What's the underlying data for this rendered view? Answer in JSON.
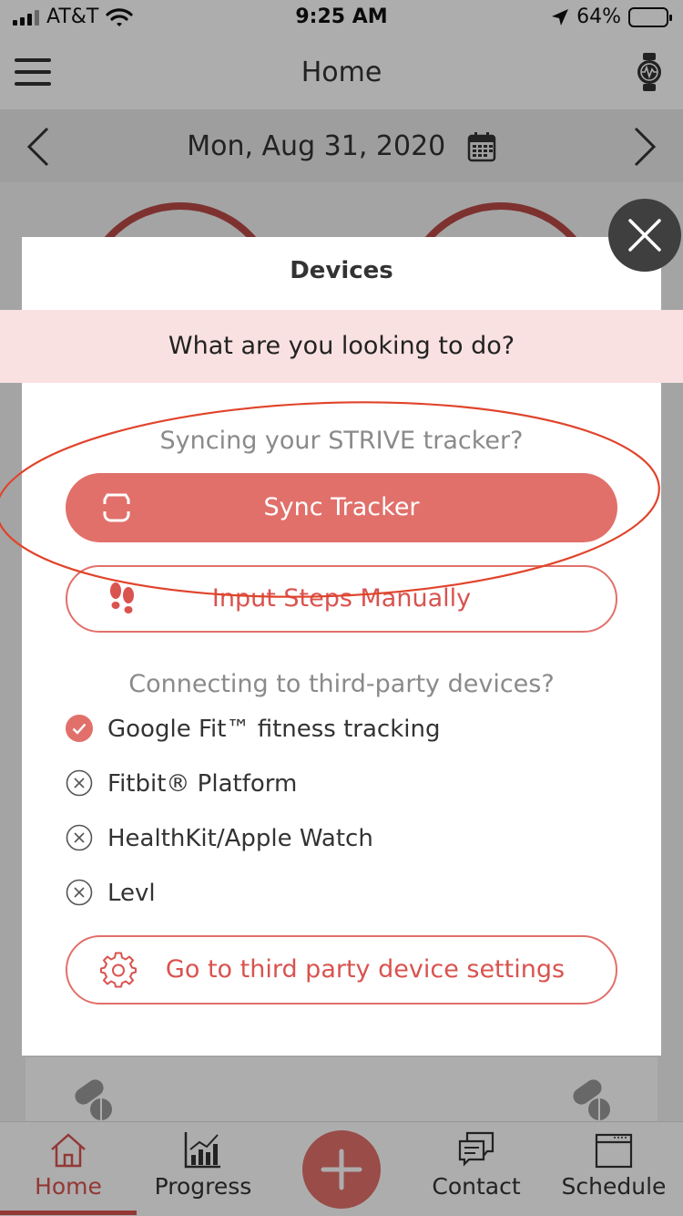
{
  "status_bar": {
    "carrier": "AT&T",
    "time": "9:25 AM",
    "battery": "64%",
    "battery_level": 0.64
  },
  "nav": {
    "title": "Home",
    "menu_icon": "hamburger-icon",
    "device_icon": "watch-icon"
  },
  "date_bar": {
    "date": "Mon, Aug 31, 2020",
    "prev_icon": "chevron-left-icon",
    "next_icon": "chevron-right-icon",
    "calendar_icon": "calendar-icon"
  },
  "modal": {
    "title": "Devices",
    "prompt": "What are you looking to do?",
    "strive_section": {
      "title": "Syncing your STRIVE tracker?",
      "sync_button": "Sync Tracker",
      "manual_button": "Input Steps Manually"
    },
    "third_party_section": {
      "title": "Connecting to third-party devices?",
      "devices": [
        {
          "label": "Google Fit™ fitness tracking",
          "connected": true
        },
        {
          "label": "Fitbit® Platform",
          "connected": false
        },
        {
          "label": "HealthKit/Apple Watch",
          "connected": false
        },
        {
          "label": "Levl",
          "connected": false
        }
      ],
      "settings_button": "Go to third party device settings"
    }
  },
  "tabs": [
    {
      "label": "Home",
      "icon": "home-icon",
      "active": true
    },
    {
      "label": "Progress",
      "icon": "chart-icon",
      "active": false
    },
    {
      "label": "Contact",
      "icon": "chat-icon",
      "active": false
    },
    {
      "label": "Schedule",
      "icon": "calendar-icon",
      "active": false
    }
  ],
  "colors": {
    "accent": "#E1706A",
    "banner": "#F8E1E0",
    "annotation": "#E0442B",
    "active_tab": "#D9534F"
  }
}
